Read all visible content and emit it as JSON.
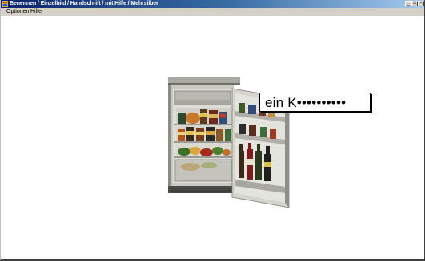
{
  "window": {
    "title": "Benennen / Einzelbild / Handschrift / mit Hilfe / Mehrsilber",
    "controls": {
      "minimize": "_",
      "maximize": "□",
      "close": "×"
    }
  },
  "menu": {
    "items": [
      {
        "label": "Optionen"
      },
      {
        "label": "Hilfe"
      }
    ]
  },
  "image": {
    "icon": "refrigerator-photo"
  },
  "answer": {
    "text": "ein K••••••••••"
  }
}
